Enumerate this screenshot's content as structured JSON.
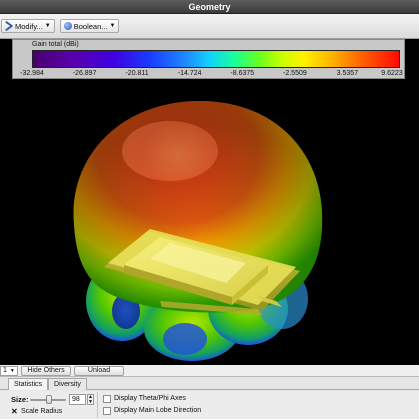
{
  "window": {
    "title": "Geometry"
  },
  "toolbar": {
    "modify_label": "Modify...",
    "boolean_label": "Boolean..."
  },
  "legend": {
    "title": "Gain total (dBi)",
    "ticks": [
      "-32.984",
      "-26.897",
      "-20.811",
      "-14.724",
      "-8.6375",
      "-2.5509",
      "3.5357",
      "9.6223"
    ],
    "min": -32.984,
    "max": 9.6223
  },
  "bottom": {
    "selector_value": "1",
    "hide_others_label": "Hide Others",
    "unload_label": "Unload",
    "tabs": [
      {
        "label": "Statistics"
      },
      {
        "label": "Diversity"
      }
    ],
    "size_label": "Size:",
    "size_value": "98",
    "scale_radius_label": "Scale Radius",
    "display_theta_phi_label": "Display Theta/Phi Axes",
    "display_main_lobe_label": "Display Main Lobe Direction"
  },
  "colors": {
    "viewport_bg": "#000000",
    "panel_bg": "#e6e6e6",
    "gain_max": "#ff1500",
    "gain_mid": "#8fe000",
    "gain_low": "#1e5cff"
  }
}
